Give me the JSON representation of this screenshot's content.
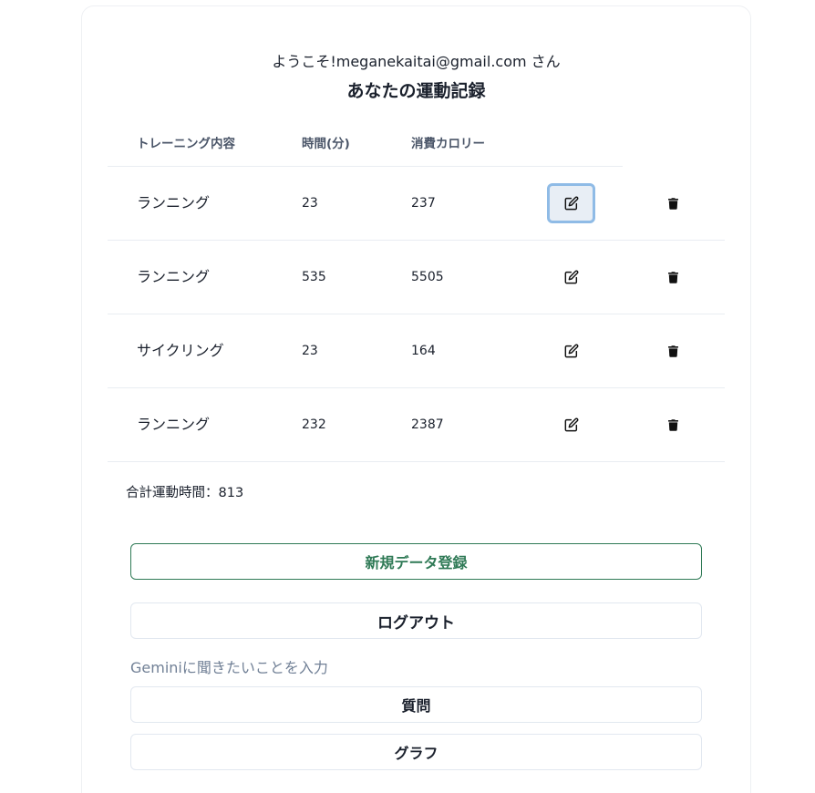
{
  "header": {
    "welcome": "ようこそ!meganekaitai@gmail.com さん",
    "title": "あなたの運動記録"
  },
  "table": {
    "columns": [
      "トレーニング内容",
      "時間(分)",
      "消費カロリー"
    ],
    "rows": [
      {
        "training": "ランニング",
        "minutes": "23",
        "calories": "237"
      },
      {
        "training": "ランニング",
        "minutes": "535",
        "calories": "5505"
      },
      {
        "training": "サイクリング",
        "minutes": "23",
        "calories": "164"
      },
      {
        "training": "ランニング",
        "minutes": "232",
        "calories": "2387"
      }
    ],
    "row_actions": {
      "edit_icon": "edit-icon",
      "delete_icon": "trash-icon"
    }
  },
  "summary": {
    "total_time": "合計運動時間：813"
  },
  "actions": {
    "new_entry": "新規データ登録",
    "logout": "ログアウト",
    "gemini_placeholder": "Geminiに聞きたいことを入力",
    "ask": "質問",
    "graph": "グラフ"
  },
  "colors": {
    "primary": "#2f7a56",
    "focus_ring": "#8fbbe6",
    "border": "#e2e8f0",
    "muted_text": "#718096"
  }
}
